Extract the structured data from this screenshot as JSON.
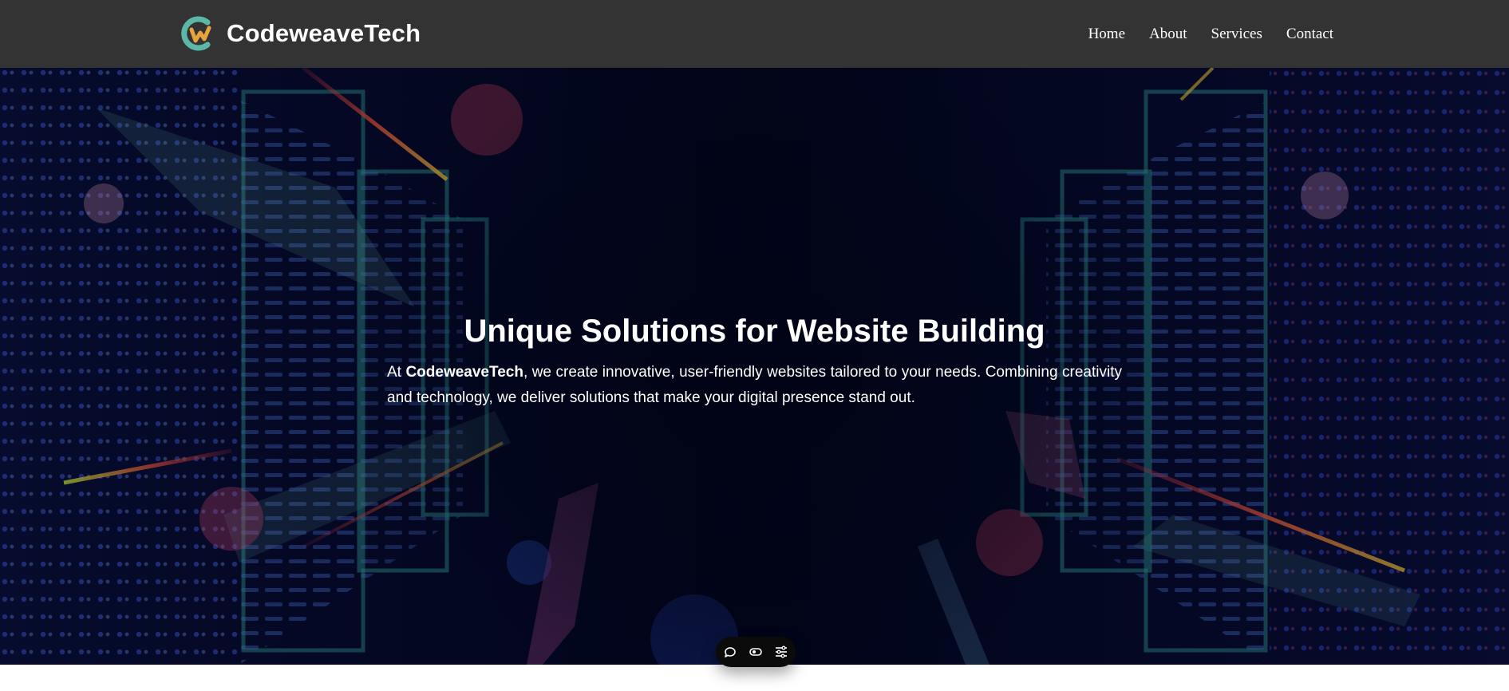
{
  "brand": {
    "name": "CodeweaveTech",
    "logo_icon": "codeweave-logo",
    "colors": {
      "ring": "#5bb7a8",
      "mark": "#e8a33c"
    }
  },
  "nav": {
    "items": [
      {
        "label": "Home"
      },
      {
        "label": "About"
      },
      {
        "label": "Services"
      },
      {
        "label": "Contact"
      }
    ]
  },
  "hero": {
    "title": "Unique Solutions for Website Building",
    "text_prefix": "At ",
    "text_brand": "CodeweaveTech",
    "text_suffix": ", we create innovative, user-friendly websites tailored to your needs. Combining creativity and technology, we deliver solutions that make your digital presence stand out."
  },
  "toolbar": {
    "buttons": [
      {
        "icon": "chat-bubble-icon"
      },
      {
        "icon": "toggle-icon"
      },
      {
        "icon": "sliders-icon"
      }
    ]
  },
  "colors": {
    "navbar_bg": "#333333",
    "hero_bg": "#02051a",
    "text": "#ffffff",
    "toolbar_bg": "#0b0b0b"
  }
}
